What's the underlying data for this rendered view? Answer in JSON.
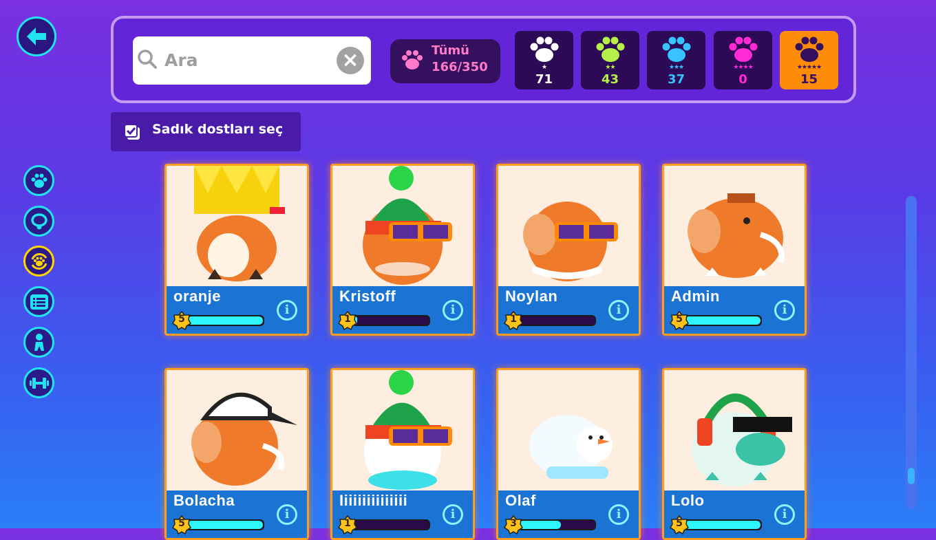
{
  "search": {
    "placeholder": "Ara"
  },
  "all": {
    "label": "Tümü",
    "count": "166/350"
  },
  "rarities": [
    {
      "stars": "★",
      "count": "71",
      "color": "#ffffff"
    },
    {
      "stars": "★★",
      "count": "43",
      "color": "#b8f04a"
    },
    {
      "stars": "★★★",
      "count": "37",
      "color": "#36c3ff"
    },
    {
      "stars": "★★★★",
      "count": "0",
      "color": "#ff2ad4"
    },
    {
      "stars": "★★★★★",
      "count": "15",
      "color": "#35105e",
      "selected": true
    }
  ],
  "select_loyal": {
    "label": "Sadık dostları seç"
  },
  "sidebar": [
    "paw-icon",
    "collar-icon",
    "pet-cycle-icon",
    "list-icon",
    "character-icon",
    "dumbbell-icon"
  ],
  "pets": [
    {
      "name": "oranje",
      "level": "5",
      "progress": 1.0,
      "kind": "fox"
    },
    {
      "name": "Kristoff",
      "level": "1",
      "progress": 0.05,
      "kind": "mammoth-hat"
    },
    {
      "name": "Noylan",
      "level": "1",
      "progress": 0.0,
      "kind": "mammoth-glasses"
    },
    {
      "name": "Admin",
      "level": "5",
      "progress": 1.0,
      "kind": "mammoth"
    },
    {
      "name": "Bolacha",
      "level": "5",
      "progress": 1.0,
      "kind": "mammoth-cap"
    },
    {
      "name": "Iiiiiiiiiiiiiii",
      "level": "1",
      "progress": 0.0,
      "kind": "snowball-hat"
    },
    {
      "name": "Olaf",
      "level": "3",
      "progress": 0.55,
      "kind": "snowball"
    },
    {
      "name": "Lolo",
      "level": "5",
      "progress": 1.0,
      "kind": "yeti"
    }
  ]
}
